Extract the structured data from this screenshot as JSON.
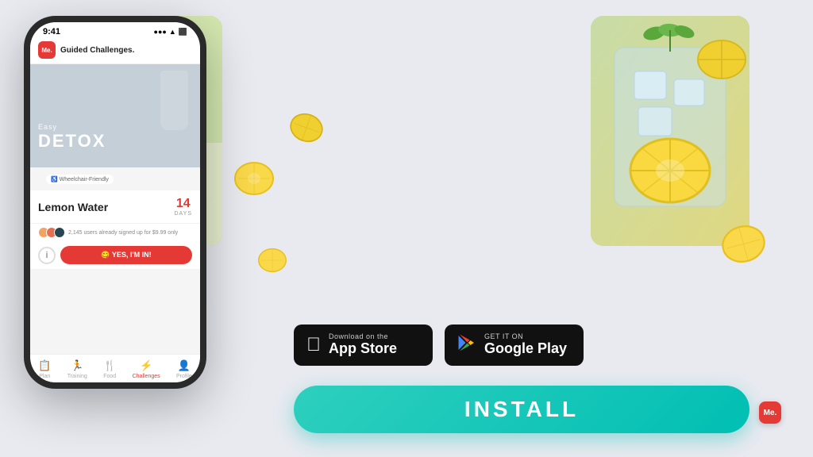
{
  "app": {
    "title": "Me. Guided Challenges.",
    "me_logo": "Me.",
    "header_title": "Guided Challenges."
  },
  "phone": {
    "status_time": "9:41",
    "status_icons": "●●● ▲ ⬛",
    "challenge_easy": "Easy",
    "challenge_name": "DETOX",
    "wheelchair_label": "♿ Wheelchair-Friendly",
    "lemon_water": "Lemon Water",
    "days_number": "14",
    "days_label": "DAYS",
    "users_text": "2,145 users already signed up for $9.99 only",
    "join_btn": "😋 YES, I'M IN!",
    "nav_items": [
      {
        "label": "Plan",
        "icon": "📋",
        "active": false
      },
      {
        "label": "Training",
        "icon": "🏃",
        "active": false
      },
      {
        "label": "Food",
        "icon": "🍴",
        "active": false
      },
      {
        "label": "Challenges",
        "icon": "⚡",
        "active": true
      },
      {
        "label": "Profile",
        "icon": "👤",
        "active": false
      }
    ]
  },
  "store": {
    "apple": {
      "subtitle": "Download on the",
      "name": "App Store",
      "icon": "🍎"
    },
    "google": {
      "subtitle": "GET IT ON",
      "name": "Google Play",
      "icon": "▶"
    }
  },
  "install": {
    "label": "INSTALL"
  },
  "watermark": "Me."
}
